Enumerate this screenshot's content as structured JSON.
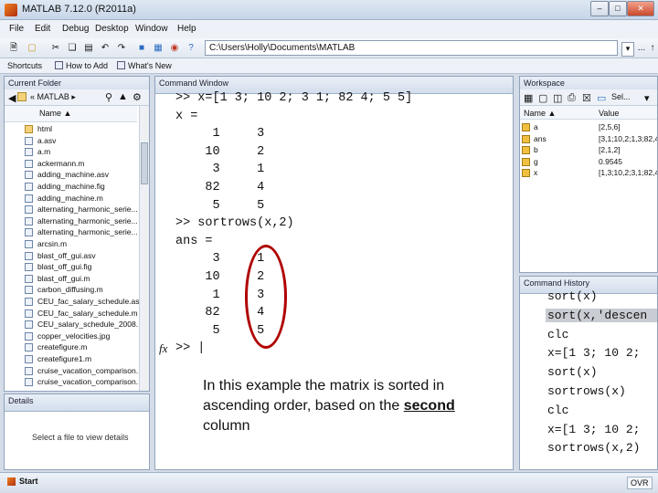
{
  "window": {
    "title": "MATLAB 7.12.0 (R2011a)",
    "buttons": [
      "–",
      "□",
      "✕"
    ]
  },
  "menu": [
    "File",
    "Edit",
    "Debug",
    "Desktop",
    "Window",
    "Help"
  ],
  "toolbar": {
    "icons": [
      "new-file",
      "open-folder",
      "cut",
      "copy",
      "paste",
      "undo",
      "redo",
      "simulink",
      "guide",
      "profiler",
      "help"
    ],
    "current_folder_path": "C:\\Users\\Holly\\Documents\\MATLAB",
    "browse_label": "...",
    "up_label": "↑"
  },
  "shortcuts": {
    "items": [
      "Shortcuts",
      "How to Add",
      "What's New"
    ]
  },
  "current_folder": {
    "title": "Current Folder",
    "nav_path": "« MATLAB ▸",
    "column": "Name ▲",
    "files": [
      {
        "name": "html",
        "type": "folder"
      },
      {
        "name": "a.asv",
        "type": "file"
      },
      {
        "name": "a.m",
        "type": "file"
      },
      {
        "name": "ackermann.m",
        "type": "file"
      },
      {
        "name": "adding_machine.asv",
        "type": "file"
      },
      {
        "name": "adding_machine.fig",
        "type": "file"
      },
      {
        "name": "adding_machine.m",
        "type": "file"
      },
      {
        "name": "alternating_harmonic_serie...",
        "type": "file"
      },
      {
        "name": "alternating_harmonic_serie...",
        "type": "file"
      },
      {
        "name": "alternating_harmonic_serie...",
        "type": "file"
      },
      {
        "name": "arcsin.m",
        "type": "file"
      },
      {
        "name": "blast_off_gui.asv",
        "type": "file"
      },
      {
        "name": "blast_off_gui.fig",
        "type": "file"
      },
      {
        "name": "blast_off_gui.m",
        "type": "file"
      },
      {
        "name": "carbon_diffusing.m",
        "type": "file"
      },
      {
        "name": "CEU_fac_salary_schedule.asv",
        "type": "file"
      },
      {
        "name": "CEU_fac_salary_schedule.m",
        "type": "file"
      },
      {
        "name": "CEU_salary_schedule_2008...",
        "type": "file"
      },
      {
        "name": "copper_velocities.jpg",
        "type": "file"
      },
      {
        "name": "createfigure.m",
        "type": "file"
      },
      {
        "name": "createfigure1.m",
        "type": "file"
      },
      {
        "name": "cruise_vacation_comparison...",
        "type": "file"
      },
      {
        "name": "cruise_vacation_comparison...",
        "type": "file"
      }
    ]
  },
  "details": {
    "title": "Details",
    "message": "Select a file to view details"
  },
  "command_window": {
    "title": "Command Window",
    "lines": [
      ">> x=[1 3; 10 2; 3 1; 82 4; 5 5]",
      "x =",
      "     1     3",
      "    10     2",
      "     3     1",
      "    82     4",
      "     5     5",
      ">> sortrows(x,2)",
      "ans =",
      "     3     1",
      "    10     2",
      "     1     3",
      "    82     4",
      "     5     5"
    ],
    "fx_label": "fx",
    "prompt": ">> |",
    "annotation_before": "In this example the matrix is sorted in ascending order, based on the ",
    "annotation_emph": "second",
    "annotation_after": " column"
  },
  "workspace": {
    "title": "Workspace",
    "select_label": "Sel...",
    "columns": [
      "Name ▲",
      "Value"
    ],
    "vars": [
      {
        "name": "a",
        "value": "[2,5,6]"
      },
      {
        "name": "ans",
        "value": "[3,1;10,2;1,3;82,4;..."
      },
      {
        "name": "b",
        "value": "[2,1,2]"
      },
      {
        "name": "g",
        "value": "0.9545"
      },
      {
        "name": "x",
        "value": "[1,3;10,2;3,1;82,4;5..."
      }
    ]
  },
  "history": {
    "title": "Command History",
    "lines": [
      "sort(x)",
      "sort(x,'descen",
      "clc",
      "x=[1 3; 10 2;",
      "sort(x)",
      "sortrows(x)",
      "clc",
      "x=[1 3; 10 2;",
      "sortrows(x,2)"
    ],
    "selected_index": 1
  },
  "status": {
    "start_label": "Start",
    "ovr_label": "OVR"
  }
}
